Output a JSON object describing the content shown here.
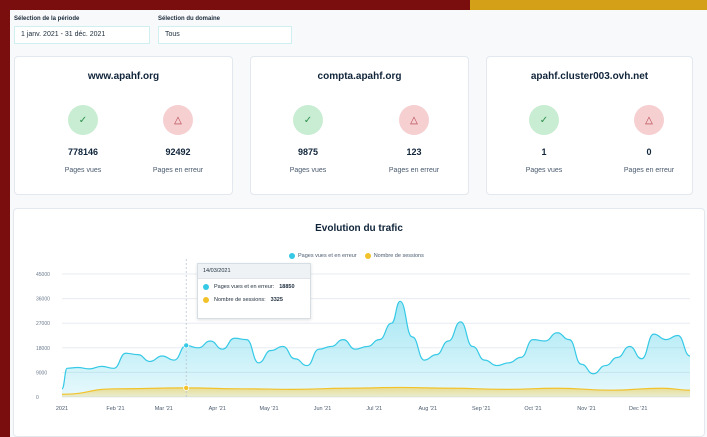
{
  "filters": {
    "period_label": "Sélection de la période",
    "period_value": "1 janv. 2021 - 31 déc. 2021",
    "domain_label": "Sélection du domaine",
    "domain_value": "Tous"
  },
  "sites": [
    {
      "name": "www.apahf.org",
      "views": "778146",
      "errors": "92492",
      "views_label": "Pages vues",
      "errors_label": "Pages en erreur"
    },
    {
      "name": "compta.apahf.org",
      "views": "9875",
      "errors": "123",
      "views_label": "Pages vues",
      "errors_label": "Pages en erreur"
    },
    {
      "name": "apahf.cluster003.ovh.net",
      "views": "1",
      "errors": "0",
      "views_label": "Pages vues",
      "errors_label": "Pages en erreur"
    }
  ],
  "icons": {
    "ok": "check-icon",
    "error": "warning-triangle-icon"
  },
  "colors": {
    "pages": "#35c9e6",
    "sessions": "#f2c22b",
    "ok_bg": "#c8edd2",
    "err_bg": "#f6cfd1"
  },
  "chart_title": "Evolution du trafic",
  "tooltip": {
    "date": "14/03/2021",
    "row1_label": "Pages vues et en erreur:",
    "row1_value": "18850",
    "row2_label": "Nombre de sessions:",
    "row2_value": "3325"
  },
  "chart_data": {
    "type": "area",
    "title": "Evolution du trafic",
    "xlabel": "",
    "ylabel": "",
    "ylim": [
      0,
      45000
    ],
    "y_ticks": [
      "0",
      "9000",
      "18000",
      "27000",
      "36000",
      "45000"
    ],
    "x_ticks": [
      "2021",
      "Feb '21",
      "Mar '21",
      "Apr '21",
      "May '21",
      "Jun '21",
      "Jul '21",
      "Aug '21",
      "Sep '21",
      "Oct '21",
      "Nov '21",
      "Dec '21"
    ],
    "legend_position": "top-center",
    "grid": true,
    "series": [
      {
        "name": "Pages vues et en erreur",
        "color": "#35c9e6",
        "points": [
          [
            "2021-01-01",
            3000
          ],
          [
            "2021-01-04",
            10500
          ],
          [
            "2021-01-10",
            10800
          ],
          [
            "2021-01-17",
            10300
          ],
          [
            "2021-01-24",
            11200
          ],
          [
            "2021-01-31",
            10500
          ],
          [
            "2021-02-07",
            16000
          ],
          [
            "2021-02-14",
            15500
          ],
          [
            "2021-02-21",
            13000
          ],
          [
            "2021-02-28",
            15000
          ],
          [
            "2021-03-07",
            13500
          ],
          [
            "2021-03-14",
            18850
          ],
          [
            "2021-03-21",
            18000
          ],
          [
            "2021-03-28",
            20500
          ],
          [
            "2021-04-04",
            17500
          ],
          [
            "2021-04-11",
            21500
          ],
          [
            "2021-04-18",
            21000
          ],
          [
            "2021-04-25",
            12500
          ],
          [
            "2021-05-02",
            17000
          ],
          [
            "2021-05-09",
            18500
          ],
          [
            "2021-05-16",
            14000
          ],
          [
            "2021-05-23",
            11500
          ],
          [
            "2021-05-30",
            17500
          ],
          [
            "2021-06-06",
            18500
          ],
          [
            "2021-06-13",
            21000
          ],
          [
            "2021-06-20",
            17500
          ],
          [
            "2021-06-27",
            18500
          ],
          [
            "2021-07-04",
            21000
          ],
          [
            "2021-07-11",
            27000
          ],
          [
            "2021-07-16",
            35000
          ],
          [
            "2021-07-23",
            22000
          ],
          [
            "2021-07-30",
            13500
          ],
          [
            "2021-08-06",
            15500
          ],
          [
            "2021-08-13",
            20500
          ],
          [
            "2021-08-20",
            27500
          ],
          [
            "2021-08-27",
            18500
          ],
          [
            "2021-09-03",
            13500
          ],
          [
            "2021-09-10",
            11500
          ],
          [
            "2021-09-17",
            12500
          ],
          [
            "2021-09-24",
            14500
          ],
          [
            "2021-10-01",
            21000
          ],
          [
            "2021-10-08",
            20500
          ],
          [
            "2021-10-15",
            23500
          ],
          [
            "2021-10-22",
            21000
          ],
          [
            "2021-10-29",
            12000
          ],
          [
            "2021-11-05",
            8500
          ],
          [
            "2021-11-12",
            11500
          ],
          [
            "2021-11-19",
            14500
          ],
          [
            "2021-11-26",
            18500
          ],
          [
            "2021-12-03",
            14000
          ],
          [
            "2021-12-10",
            23000
          ],
          [
            "2021-12-17",
            21000
          ],
          [
            "2021-12-24",
            22500
          ],
          [
            "2021-12-31",
            15000
          ]
        ]
      },
      {
        "name": "Nombre de sessions",
        "color": "#f2c22b",
        "points": [
          [
            "2021-01-01",
            1000
          ],
          [
            "2021-02-01",
            3000
          ],
          [
            "2021-03-14",
            3325
          ],
          [
            "2021-04-15",
            3000
          ],
          [
            "2021-05-15",
            2800
          ],
          [
            "2021-06-15",
            3200
          ],
          [
            "2021-07-16",
            3500
          ],
          [
            "2021-08-15",
            3200
          ],
          [
            "2021-09-15",
            2800
          ],
          [
            "2021-10-15",
            3200
          ],
          [
            "2021-11-15",
            2500
          ],
          [
            "2021-12-15",
            3200
          ],
          [
            "2021-12-31",
            2500
          ]
        ]
      }
    ]
  }
}
